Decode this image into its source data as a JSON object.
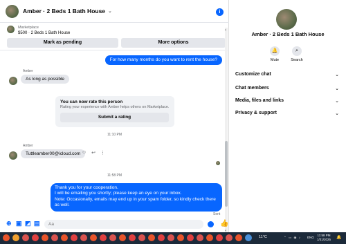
{
  "header": {
    "title": "Amber · 2 Beds 1 Bath House",
    "info_icon": "i"
  },
  "listing": {
    "category": "Marketplace",
    "name": "$500 · 2 Beds 1 Bath House",
    "mark_pending_label": "Mark as pending",
    "more_options_label": "More options"
  },
  "messages": {
    "out_1": "For how many months do you want to rent the house?",
    "sender_1": "Amber",
    "in_1": "As long as possible",
    "rating": {
      "title": "You can now rate this person",
      "subtitle": "Rating your experience with Amber helps others on Marketplace.",
      "button": "Submit a rating"
    },
    "time_1": "11:10 PM",
    "sender_2": "Amber",
    "in_2": "Tuttleamber00@icloud.com",
    "time_2": "11:58 PM",
    "out_2_lines": [
      "Thank you for your cooperation.",
      "I will be emailing you shortly; please keep an eye on your inbox.",
      "Note: Occasionally, emails may end up in your spam folder, so kindly check there as well."
    ],
    "status": "Sent"
  },
  "composer": {
    "placeholder": "Aa"
  },
  "details": {
    "name": "Amber · 2 Beds 1 Bath House",
    "mute_label": "Mute",
    "search_label": "Search",
    "sections": [
      "Customize chat",
      "Chat members",
      "Media, files and links",
      "Privacy & support"
    ]
  },
  "taskbar": {
    "weather": "11°C",
    "lang": "ENG",
    "time": "11:58 PM",
    "date": "1/31/2025"
  },
  "colors": {
    "accent": "#0866ff",
    "bubble_in": "#e4e6eb",
    "taskbar": "#1c2a3a"
  },
  "icons": [
    "info-icon",
    "bell-icon",
    "search-icon",
    "chevron-down-icon",
    "plus-icon",
    "image-icon",
    "sticker-icon",
    "gif-icon",
    "emoji-icon",
    "thumbs-up-icon",
    "reply-icon",
    "more-icon"
  ]
}
